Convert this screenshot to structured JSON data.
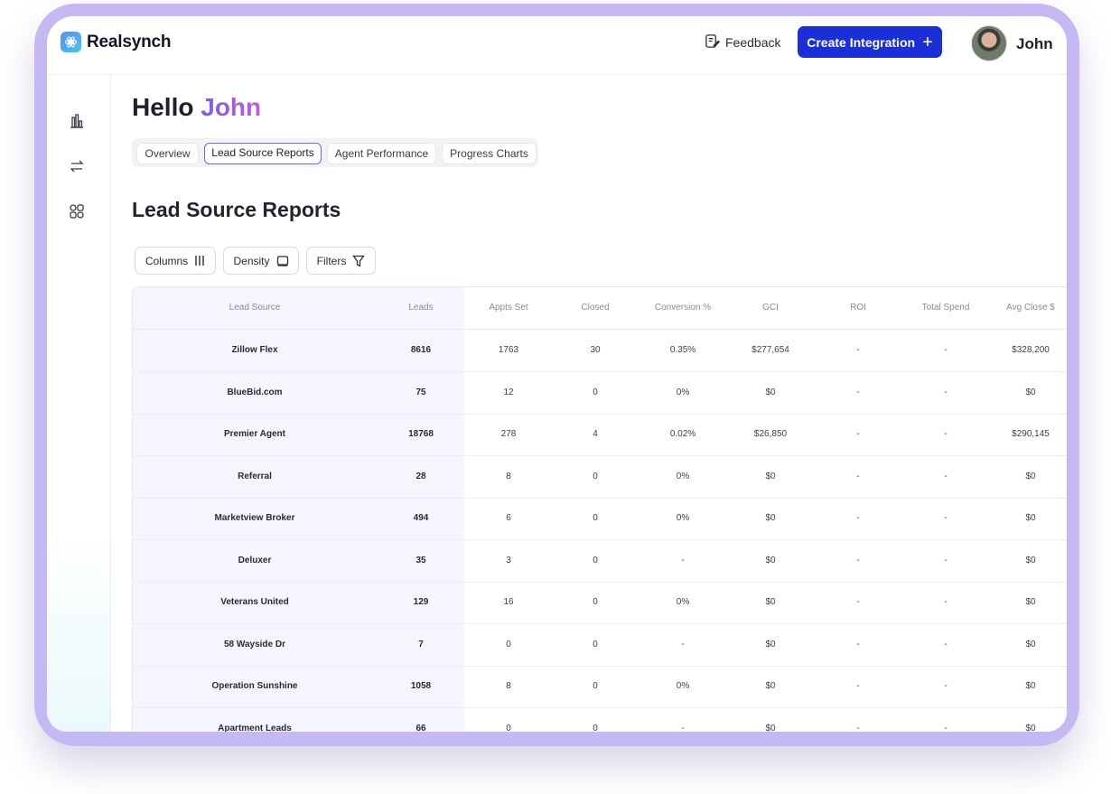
{
  "app": {
    "name": "Realsynch"
  },
  "header": {
    "feedback_label": "Feedback",
    "create_label": "Create Integration",
    "create_plus": "+",
    "user_name": "John"
  },
  "sidebar": {
    "items": [
      {
        "icon": "bar-chart-icon"
      },
      {
        "icon": "swap-arrows-icon"
      },
      {
        "icon": "integrations-icon"
      }
    ]
  },
  "greeting": {
    "prefix": "Hello",
    "name": "John"
  },
  "tabs": [
    {
      "label": "Overview",
      "active": false
    },
    {
      "label": "Lead Source Reports",
      "active": true
    },
    {
      "label": "Agent Performance",
      "active": false
    },
    {
      "label": "Progress Charts",
      "active": false
    }
  ],
  "section_title": "Lead Source Reports",
  "toolbar": {
    "columns_label": "Columns",
    "density_label": "Density",
    "filters_label": "Filters"
  },
  "table": {
    "columns": [
      "Lead Source",
      "Leads",
      "Appts Set",
      "Closed",
      "Conversion %",
      "GCI",
      "ROI",
      "Total Spend",
      "Avg Close $"
    ],
    "rows": [
      [
        "Zillow Flex",
        "8616",
        "1763",
        "30",
        "0.35%",
        "$277,654",
        "-",
        "-",
        "$328,200"
      ],
      [
        "BlueBid.com",
        "75",
        "12",
        "0",
        "0%",
        "$0",
        "-",
        "-",
        "$0"
      ],
      [
        "Premier Agent",
        "18768",
        "278",
        "4",
        "0.02%",
        "$26,850",
        "-",
        "-",
        "$290,145"
      ],
      [
        "Referral",
        "28",
        "8",
        "0",
        "0%",
        "$0",
        "-",
        "-",
        "$0"
      ],
      [
        "Marketview Broker",
        "494",
        "6",
        "0",
        "0%",
        "$0",
        "-",
        "-",
        "$0"
      ],
      [
        "Deluxer",
        "35",
        "3",
        "0",
        "-",
        "$0",
        "-",
        "-",
        "$0"
      ],
      [
        "Veterans United",
        "129",
        "16",
        "0",
        "0%",
        "$0",
        "-",
        "-",
        "$0"
      ],
      [
        "58 Wayside Dr",
        "7",
        "0",
        "0",
        "-",
        "$0",
        "-",
        "-",
        "$0"
      ],
      [
        "Operation Sunshine",
        "1058",
        "8",
        "0",
        "0%",
        "$0",
        "-",
        "-",
        "$0"
      ],
      [
        "Apartment Leads",
        "66",
        "0",
        "0",
        "-",
        "$0",
        "-",
        "-",
        "$0"
      ]
    ]
  },
  "colors": {
    "frame": "#c6b8f3",
    "primary_button": "#1b2fd9",
    "name_gradient_start": "#7b5cf0",
    "name_gradient_end": "#c45ad7",
    "active_tab_border": "#8a5cdc",
    "pinned_column_bg": "#f5f5fd"
  }
}
